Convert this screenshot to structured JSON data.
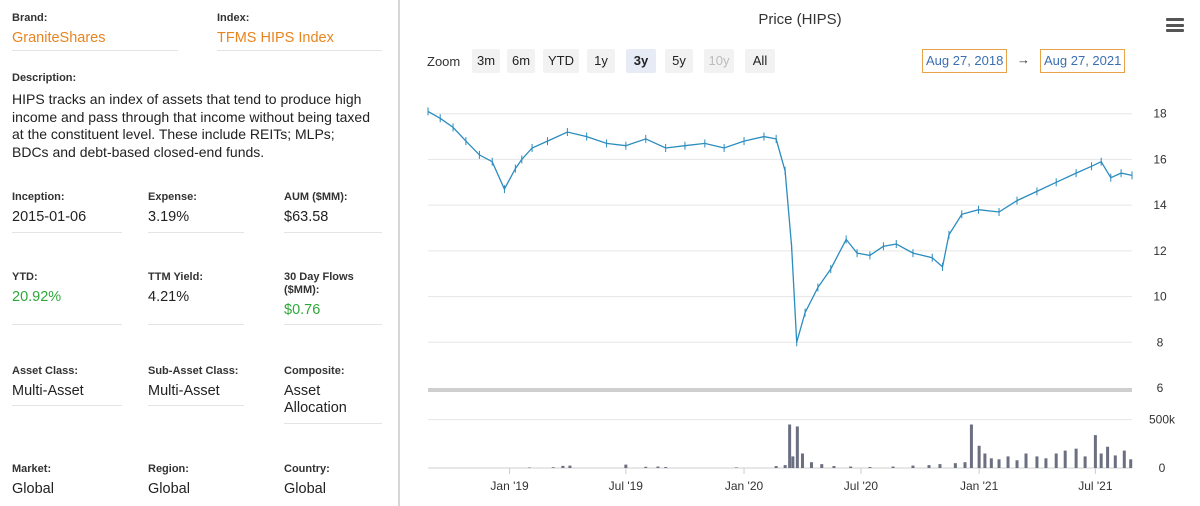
{
  "fields": {
    "brand": {
      "label": "Brand:",
      "value": "GraniteShares"
    },
    "index": {
      "label": "Index:",
      "value": "TFMS HIPS Index"
    },
    "description": {
      "label": "Description:",
      "value": "HIPS tracks an index of assets that tend to produce high income and pass through that income without being taxed at the constituent level. These include REITs; MLPs; BDCs and debt-based closed-end funds."
    },
    "inception": {
      "label": "Inception:",
      "value": "2015-01-06"
    },
    "expense": {
      "label": "Expense:",
      "value": "3.19%"
    },
    "aum": {
      "label": "AUM ($MM):",
      "value": "$63.58"
    },
    "ytd": {
      "label": "YTD:",
      "value": "20.92%"
    },
    "ttm_yield": {
      "label": "TTM Yield:",
      "value": "4.21%"
    },
    "flows": {
      "label": "30 Day Flows ($MM):",
      "value": "$0.76"
    },
    "asset_class": {
      "label": "Asset Class:",
      "value": "Multi-Asset"
    },
    "sub_asset_class": {
      "label": "Sub-Asset Class:",
      "value": "Multi-Asset"
    },
    "composite": {
      "label": "Composite:",
      "value": "Asset Allocation"
    },
    "market": {
      "label": "Market:",
      "value": "Global"
    },
    "region": {
      "label": "Region:",
      "value": "Global"
    },
    "country": {
      "label": "Country:",
      "value": "Global"
    }
  },
  "colors": {
    "orange": "#e8841f",
    "green": "#2fa63a",
    "line": "#2b8cbe",
    "volume": "#6b6f80"
  },
  "chart": {
    "title": "Price (HIPS)",
    "zoom_label": "Zoom",
    "zoom_buttons": [
      {
        "label": "3m",
        "state": "normal"
      },
      {
        "label": "6m",
        "state": "normal"
      },
      {
        "label": "YTD",
        "state": "normal"
      },
      {
        "label": "1y",
        "state": "normal"
      },
      {
        "label": "3y",
        "state": "active"
      },
      {
        "label": "5y",
        "state": "normal"
      },
      {
        "label": "10y",
        "state": "disabled"
      },
      {
        "label": "All",
        "state": "normal"
      }
    ],
    "range_from": "Aug 27, 2018",
    "range_arrow": "→",
    "range_to": "Aug 27, 2021",
    "menu_icon": "hamburger-menu-icon"
  },
  "chart_data": {
    "type": "line",
    "title": "Price (HIPS)",
    "x_ticks": [
      "Jan '19",
      "Jul '19",
      "Jan '20",
      "Jul '20",
      "Jan '21",
      "Jul '21"
    ],
    "price_axis": {
      "ticks": [
        "6",
        "8",
        "10",
        "12",
        "14",
        "16",
        "18"
      ],
      "ylim": [
        6,
        18.6
      ]
    },
    "volume_axis": {
      "ticks": [
        "0",
        "500k"
      ],
      "ylim": [
        0,
        600000
      ]
    },
    "xlim": [
      "2018-08-27",
      "2021-08-27"
    ],
    "price_series": {
      "name": "HIPS",
      "points": [
        [
          "2018-08-27",
          18.1
        ],
        [
          "2018-09-15",
          17.8
        ],
        [
          "2018-10-05",
          17.4
        ],
        [
          "2018-10-25",
          16.8
        ],
        [
          "2018-11-15",
          16.2
        ],
        [
          "2018-12-05",
          15.9
        ],
        [
          "2018-12-24",
          14.7
        ],
        [
          "2019-01-10",
          15.6
        ],
        [
          "2019-01-20",
          16.0
        ],
        [
          "2019-02-05",
          16.5
        ],
        [
          "2019-03-01",
          16.8
        ],
        [
          "2019-04-01",
          17.2
        ],
        [
          "2019-05-01",
          17.0
        ],
        [
          "2019-06-01",
          16.7
        ],
        [
          "2019-07-01",
          16.6
        ],
        [
          "2019-08-01",
          16.9
        ],
        [
          "2019-09-01",
          16.5
        ],
        [
          "2019-10-01",
          16.6
        ],
        [
          "2019-11-01",
          16.7
        ],
        [
          "2019-12-01",
          16.5
        ],
        [
          "2020-01-01",
          16.8
        ],
        [
          "2020-02-01",
          17.0
        ],
        [
          "2020-02-20",
          16.9
        ],
        [
          "2020-03-05",
          15.5
        ],
        [
          "2020-03-15",
          12.2
        ],
        [
          "2020-03-23",
          8.0
        ],
        [
          "2020-04-05",
          9.3
        ],
        [
          "2020-04-25",
          10.4
        ],
        [
          "2020-05-15",
          11.2
        ],
        [
          "2020-06-08",
          12.5
        ],
        [
          "2020-06-25",
          11.9
        ],
        [
          "2020-07-15",
          11.8
        ],
        [
          "2020-08-05",
          12.2
        ],
        [
          "2020-08-25",
          12.3
        ],
        [
          "2020-09-20",
          11.9
        ],
        [
          "2020-10-20",
          11.7
        ],
        [
          "2020-11-05",
          11.3
        ],
        [
          "2020-11-15",
          12.7
        ],
        [
          "2020-12-05",
          13.6
        ],
        [
          "2020-12-31",
          13.8
        ],
        [
          "2021-02-01",
          13.7
        ],
        [
          "2021-03-01",
          14.2
        ],
        [
          "2021-04-01",
          14.6
        ],
        [
          "2021-05-01",
          15.0
        ],
        [
          "2021-06-01",
          15.4
        ],
        [
          "2021-06-25",
          15.7
        ],
        [
          "2021-07-10",
          15.9
        ],
        [
          "2021-07-25",
          15.2
        ],
        [
          "2021-08-10",
          15.4
        ],
        [
          "2021-08-27",
          15.3
        ]
      ]
    },
    "volume_series": {
      "name": "Volume",
      "points": [
        [
          "2019-02-01",
          5000
        ],
        [
          "2019-03-10",
          8000
        ],
        [
          "2019-03-25",
          22000
        ],
        [
          "2019-04-05",
          25000
        ],
        [
          "2019-07-01",
          35000
        ],
        [
          "2019-08-01",
          12000
        ],
        [
          "2019-08-20",
          15000
        ],
        [
          "2019-09-01",
          10000
        ],
        [
          "2019-12-20",
          6000
        ],
        [
          "2020-02-20",
          20000
        ],
        [
          "2020-03-05",
          30000
        ],
        [
          "2020-03-12",
          450000
        ],
        [
          "2020-03-17",
          120000
        ],
        [
          "2020-03-24",
          430000
        ],
        [
          "2020-04-01",
          150000
        ],
        [
          "2020-04-15",
          60000
        ],
        [
          "2020-05-01",
          40000
        ],
        [
          "2020-05-20",
          20000
        ],
        [
          "2020-06-15",
          15000
        ],
        [
          "2020-07-15",
          10000
        ],
        [
          "2020-08-20",
          15000
        ],
        [
          "2020-09-20",
          25000
        ],
        [
          "2020-10-15",
          30000
        ],
        [
          "2020-11-01",
          40000
        ],
        [
          "2020-11-25",
          50000
        ],
        [
          "2020-12-10",
          60000
        ],
        [
          "2020-12-20",
          450000
        ],
        [
          "2021-01-01",
          230000
        ],
        [
          "2021-01-10",
          150000
        ],
        [
          "2021-01-20",
          100000
        ],
        [
          "2021-02-01",
          90000
        ],
        [
          "2021-02-15",
          120000
        ],
        [
          "2021-03-01",
          80000
        ],
        [
          "2021-03-15",
          150000
        ],
        [
          "2021-04-01",
          120000
        ],
        [
          "2021-04-15",
          100000
        ],
        [
          "2021-05-01",
          150000
        ],
        [
          "2021-05-15",
          180000
        ],
        [
          "2021-06-01",
          200000
        ],
        [
          "2021-06-15",
          120000
        ],
        [
          "2021-07-01",
          340000
        ],
        [
          "2021-07-10",
          150000
        ],
        [
          "2021-07-20",
          220000
        ],
        [
          "2021-08-01",
          130000
        ],
        [
          "2021-08-15",
          180000
        ],
        [
          "2021-08-25",
          90000
        ]
      ]
    }
  }
}
